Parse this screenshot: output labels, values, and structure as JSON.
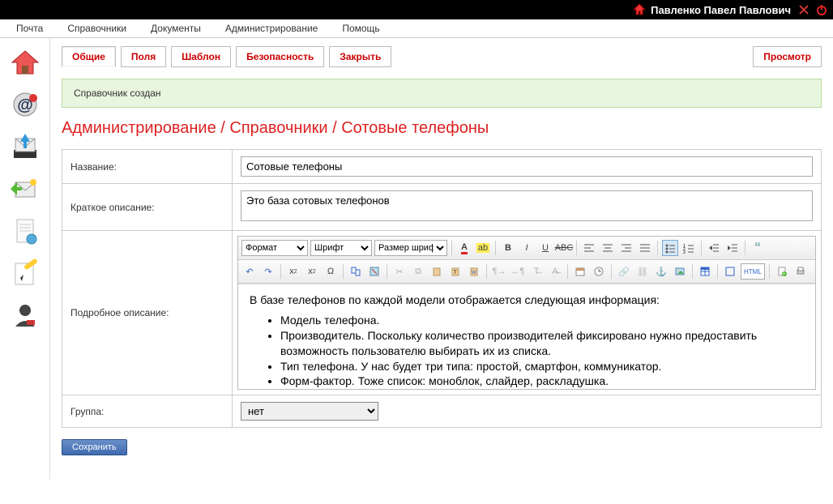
{
  "topbar": {
    "username": "Павленко Павел Павлович"
  },
  "menu": {
    "mail": "Почта",
    "dirs": "Справочники",
    "docs": "Документы",
    "admin": "Администрирование",
    "help": "Помощь"
  },
  "tabs": {
    "general": "Общие",
    "fields": "Поля",
    "template": "Шаблон",
    "security": "Безопасность",
    "close": "Закрыть",
    "preview": "Просмотр"
  },
  "notice": "Справочник создан",
  "breadcrumb": "Администрирование / Справочники / Сотовые телефоны",
  "form": {
    "name_label": "Название:",
    "name_value": "Сотовые телефоны",
    "short_label": "Краткое описание:",
    "short_value": "Это база сотовых телефонов",
    "detail_label": "Подробное описание:",
    "detail_intro": "В базе телефонов по каждой модели отображается следующая информация:",
    "detail_items": [
      "Модель телефона.",
      "Производитель. Поскольку количество производителей фиксировано нужно предоставить возможность пользователю выбирать их из списка.",
      "Тип телефона. У нас будет три типа: простой, смартфон, коммуникатор.",
      "Форм-фактор. Тоже список: моноблок, слайдер, раскладушка."
    ],
    "group_label": "Группа:",
    "group_value": "нет"
  },
  "editor_toolbar": {
    "format_label": "Формат",
    "font_label": "Шрифт",
    "size_label": "Размер шрифта",
    "html_label": "HTML"
  },
  "buttons": {
    "save": "Сохранить"
  }
}
